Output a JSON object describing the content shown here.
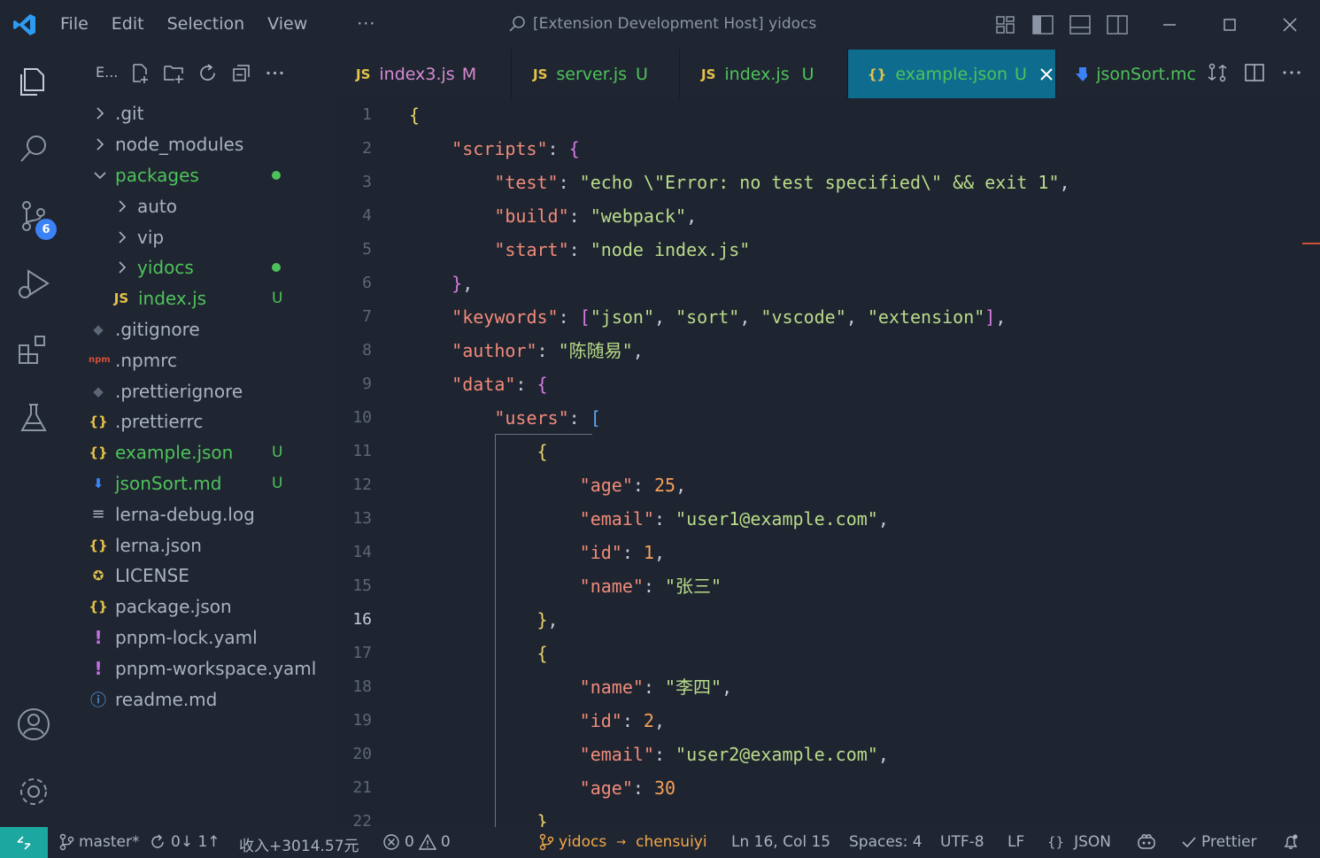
{
  "titlebar": {
    "menu": [
      "File",
      "Edit",
      "Selection",
      "View"
    ],
    "more": "···",
    "title": "[Extension Development Host] yidocs"
  },
  "activity_bar": {
    "scm_badge": "6"
  },
  "explorer": {
    "header": "E...",
    "items": [
      {
        "label": ".git",
        "type": "folder",
        "status": ""
      },
      {
        "label": "node_modules",
        "type": "folder",
        "status": ""
      },
      {
        "label": "packages",
        "type": "folder-open",
        "status": "dot"
      },
      {
        "label": "auto",
        "type": "folder",
        "status": ""
      },
      {
        "label": "vip",
        "type": "folder",
        "status": ""
      },
      {
        "label": "yidocs",
        "type": "folder",
        "status": "dot"
      },
      {
        "label": "index.js",
        "type": "js",
        "status": "U"
      },
      {
        "label": ".gitignore",
        "type": "git",
        "status": ""
      },
      {
        "label": ".npmrc",
        "type": "npm",
        "status": ""
      },
      {
        "label": ".prettierignore",
        "type": "git",
        "status": ""
      },
      {
        "label": ".prettierrc",
        "type": "json",
        "status": ""
      },
      {
        "label": "example.json",
        "type": "json",
        "status": "U"
      },
      {
        "label": "jsonSort.md",
        "type": "md",
        "status": "U"
      },
      {
        "label": "lerna-debug.log",
        "type": "log",
        "status": ""
      },
      {
        "label": "lerna.json",
        "type": "json",
        "status": ""
      },
      {
        "label": "LICENSE",
        "type": "license",
        "status": ""
      },
      {
        "label": "package.json",
        "type": "json",
        "status": ""
      },
      {
        "label": "pnpm-lock.yaml",
        "type": "yaml",
        "status": ""
      },
      {
        "label": "pnpm-workspace.yaml",
        "type": "yaml",
        "status": ""
      },
      {
        "label": "readme.md",
        "type": "info",
        "status": ""
      }
    ]
  },
  "tabs": [
    {
      "icon": "JS",
      "label": "index3.js",
      "status": "M"
    },
    {
      "icon": "JS",
      "label": "server.js",
      "status": "U"
    },
    {
      "icon": "JS",
      "label": "index.js",
      "status": "U"
    },
    {
      "icon": "{}",
      "label": "example.json",
      "status": "U"
    },
    {
      "icon": "md",
      "label": "jsonSort.mc",
      "status": ""
    }
  ],
  "editor": {
    "line_numbers": [
      "1",
      "2",
      "3",
      "4",
      "5",
      "6",
      "7",
      "8",
      "9",
      "10",
      "11",
      "12",
      "13",
      "14",
      "15",
      "16",
      "17",
      "18",
      "19",
      "20",
      "21",
      "22"
    ],
    "current_line": 16
  },
  "statusbar": {
    "branch": "master*",
    "sync": "0↓ 1↑",
    "income": "收入+3014.57元",
    "errors": "0",
    "warnings": "0",
    "repo": "yidocs",
    "arrow": "→",
    "user": "chensuiyi",
    "position": "Ln 16, Col 15",
    "spaces": "Spaces: 4",
    "encoding": "UTF-8",
    "eol": "LF",
    "language": "JSON",
    "formatter": "Prettier"
  },
  "colors": {
    "accent": "#0e6d8f",
    "remote": "#1ca7a0",
    "untracked": "#4ec25a",
    "key": "#f08b7a",
    "string": "#b9dc8a",
    "number": "#f5a05a"
  }
}
